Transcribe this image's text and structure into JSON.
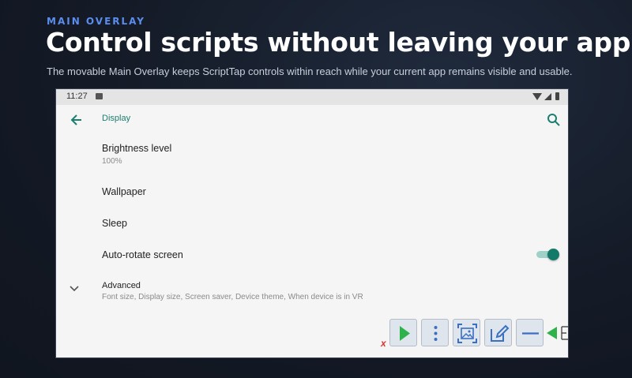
{
  "hero": {
    "eyebrow": "MAIN OVERLAY",
    "headline": "Control scripts without leaving your app",
    "subline": "The movable Main Overlay keeps ScriptTap controls within reach while your current app remains visible and usable."
  },
  "device": {
    "status_bar": {
      "time": "11:27"
    },
    "toolbar": {
      "title": "Display"
    },
    "settings": [
      {
        "title": "Brightness level",
        "subtitle": "100%"
      },
      {
        "title": "Wallpaper"
      },
      {
        "title": "Sleep"
      },
      {
        "title": "Auto-rotate screen",
        "toggle": true
      },
      {
        "title": "Advanced",
        "subtitle": "Font size, Display size, Screen saver, Device theme, When device is in VR"
      }
    ],
    "overlay": {
      "close_label": "x",
      "buttons": [
        "play-icon",
        "more-vert-icon",
        "screenshot-icon",
        "edit-icon",
        "minimize-icon"
      ],
      "accent": "#2fb24a",
      "icon_color": "#3a6fc4"
    }
  },
  "colors": {
    "eyebrow": "#5b8def",
    "teal": "#1a7f6e"
  }
}
